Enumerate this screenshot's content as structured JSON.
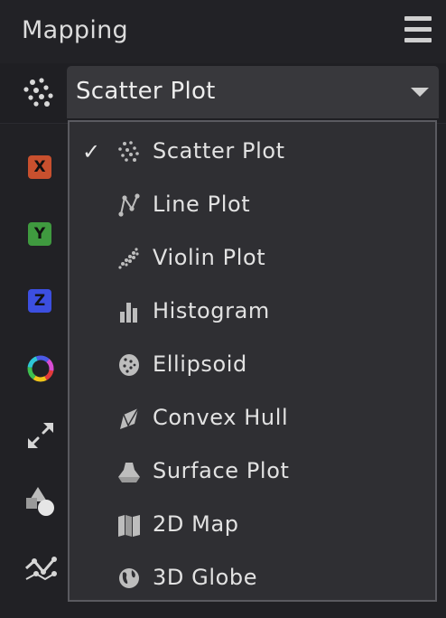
{
  "header": {
    "title": "Mapping",
    "menu_icon": "hamburger-menu-icon"
  },
  "plot_type": {
    "icon": "scatter-plot-icon",
    "selected": "Scatter Plot",
    "dropdown_icon": "caret-down-icon"
  },
  "sidebar": {
    "items": [
      {
        "name": "x-axis",
        "letter": "X",
        "color": "#c8502e"
      },
      {
        "name": "y-axis",
        "letter": "Y",
        "color": "#3f9a3f"
      },
      {
        "name": "z-axis",
        "letter": "Z",
        "color": "#3c4fe0"
      },
      {
        "name": "color",
        "icon": "color-wheel-icon"
      },
      {
        "name": "size",
        "icon": "resize-arrows-icon"
      },
      {
        "name": "shape",
        "icon": "shapes-icon"
      },
      {
        "name": "trend",
        "icon": "line-chart-icon"
      }
    ]
  },
  "dropdown": {
    "items": [
      {
        "label": "Scatter Plot",
        "icon": "scatter-plot-icon",
        "checked": true
      },
      {
        "label": "Line Plot",
        "icon": "line-plot-icon",
        "checked": false
      },
      {
        "label": "Violin Plot",
        "icon": "violin-plot-icon",
        "checked": false
      },
      {
        "label": "Histogram",
        "icon": "histogram-icon",
        "checked": false
      },
      {
        "label": "Ellipsoid",
        "icon": "ellipsoid-icon",
        "checked": false
      },
      {
        "label": "Convex Hull",
        "icon": "convex-hull-icon",
        "checked": false
      },
      {
        "label": "Surface Plot",
        "icon": "surface-plot-icon",
        "checked": false
      },
      {
        "label": "2D Map",
        "icon": "map-icon",
        "checked": false
      },
      {
        "label": "3D Globe",
        "icon": "globe-icon",
        "checked": false
      }
    ],
    "check_mark": "✓"
  }
}
